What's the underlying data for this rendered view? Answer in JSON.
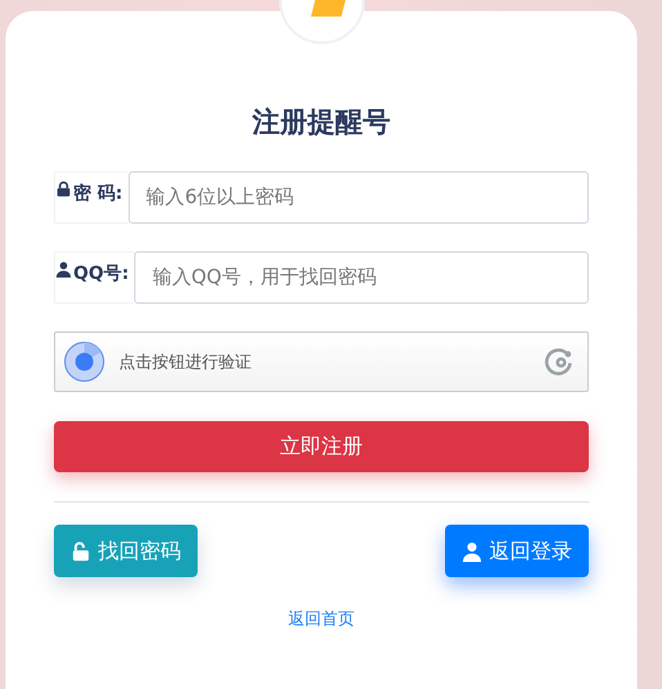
{
  "title": "注册提醒号",
  "fields": [
    {
      "label": "密 码:",
      "kind": "password",
      "placeholder": "输入6位以上密码"
    },
    {
      "label": "QQ号:",
      "kind": "user",
      "placeholder": "输入QQ号，用于找回密码"
    }
  ],
  "captcha": {
    "text": "点击按钮进行验证"
  },
  "submit": "立即注册",
  "actions": [
    {
      "label": "找回密码",
      "kind": "unlock"
    },
    {
      "label": "返回登录",
      "kind": "user"
    }
  ],
  "home_link": "返回首页"
}
